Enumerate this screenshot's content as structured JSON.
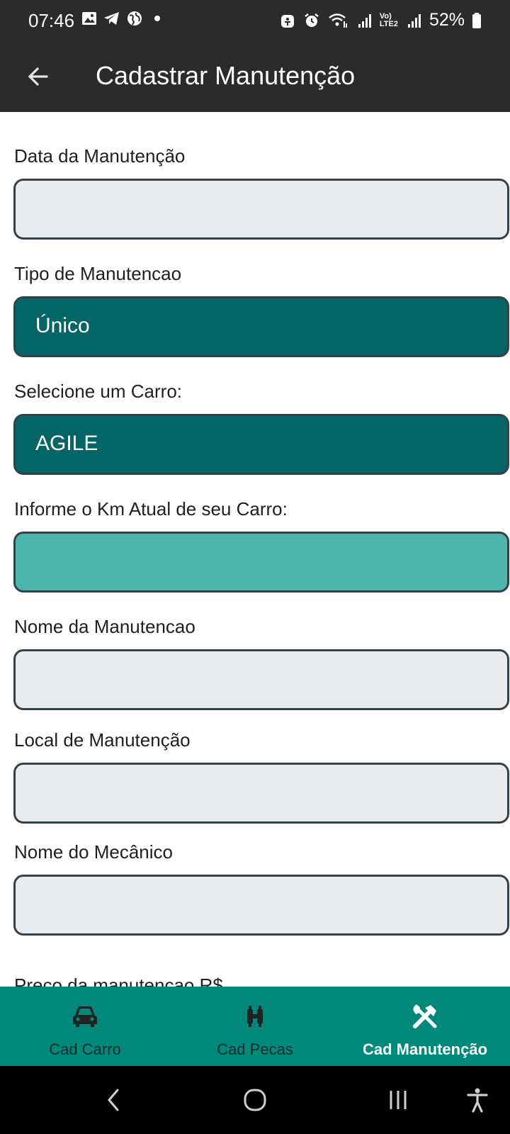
{
  "status": {
    "time": "07:46",
    "battery": "52%",
    "left_icons": [
      "gallery-icon",
      "telegram-icon",
      "globe-icon",
      "dot-icon"
    ],
    "right_icons": [
      "accessibility-icon",
      "alarm-icon",
      "wifi-icon",
      "signal-icon",
      "volte-icon",
      "signal-icon",
      "battery-icon"
    ],
    "volte_top": "Vo)",
    "volte_bottom": "LTE2"
  },
  "app_bar": {
    "title": "Cadastrar Manutenção"
  },
  "form": {
    "fields": [
      {
        "label": "Data da Manutenção",
        "value": ""
      },
      {
        "label": "Tipo de Manutencao",
        "value": "Único"
      },
      {
        "label": "Selecione um Carro:",
        "value": "AGILE"
      },
      {
        "label": "Informe o Km Atual de seu Carro:",
        "value": ""
      },
      {
        "label": "Nome da Manutencao",
        "value": ""
      },
      {
        "label": "Local de Manutenção",
        "value": ""
      },
      {
        "label": "Nome do Mecânico",
        "value": ""
      },
      {
        "label": "Preco da manutencao R$"
      }
    ]
  },
  "bottom_nav": {
    "items": [
      {
        "label": "Cad Carro",
        "icon": "car-icon",
        "active": false
      },
      {
        "label": "Cad Pecas",
        "icon": "parts-icon",
        "active": false
      },
      {
        "label": "Cad Manutenção",
        "icon": "tools-icon",
        "active": true
      }
    ]
  },
  "colors": {
    "app_bar": "#2b2b2b",
    "select_bg": "#036566",
    "km_field_bg": "#4db6ac",
    "input_bg": "#e8ecef",
    "bottom_nav_bg": "#00897b"
  }
}
